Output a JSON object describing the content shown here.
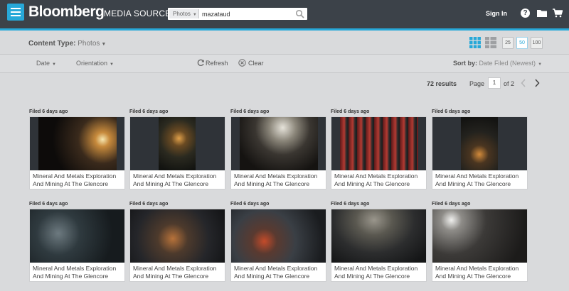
{
  "header": {
    "brand": "Bloomberg",
    "brand_sub": "MEDIA SOURCE",
    "search_type": "Photos",
    "search_value": "mazataud",
    "sign_in": "Sign In",
    "help_glyph": "?",
    "icons": [
      "menu-icon",
      "search-icon",
      "help-icon",
      "folder-icon",
      "cart-icon"
    ],
    "accent_color": "#27a8d8"
  },
  "toolbar": {
    "content_type_label": "Content Type:",
    "content_type_value": "Photos",
    "page_sizes": [
      "25",
      "50",
      "100"
    ],
    "active_page_size": "50",
    "filters": [
      "Date",
      "Orientation"
    ],
    "refresh_label": "Refresh",
    "clear_label": "Clear",
    "sort_label": "Sort by:",
    "sort_value": "Date Filed (Newest)"
  },
  "pagination": {
    "results": "72 results",
    "page_label": "Page",
    "current_page": "1",
    "of_pages": "of 2"
  },
  "items": [
    {
      "filed": "Filed 6 days ago",
      "caption": "Mineral And Metals Exploration And Mining At The Glencore"
    },
    {
      "filed": "Filed 6 days ago",
      "caption": "Mineral And Metals Exploration And Mining At The Glencore"
    },
    {
      "filed": "Filed 6 days ago",
      "caption": "Mineral And Metals Exploration And Mining At The Glencore"
    },
    {
      "filed": "Filed 6 days ago",
      "caption": "Mineral And Metals Exploration And Mining At The Glencore"
    },
    {
      "filed": "Filed 6 days ago",
      "caption": "Mineral And Metals Exploration And Mining At The Glencore"
    },
    {
      "filed": "Filed 6 days ago",
      "caption": "Mineral And Metals Exploration And Mining At The Glencore"
    },
    {
      "filed": "Filed 6 days ago",
      "caption": "Mineral And Metals Exploration And Mining At The Glencore"
    },
    {
      "filed": "Filed 6 days ago",
      "caption": "Mineral And Metals Exploration And Mining At The Glencore"
    },
    {
      "filed": "Filed 6 days ago",
      "caption": "Mineral And Metals Exploration And Mining At The Glencore"
    },
    {
      "filed": "Filed 6 days ago",
      "caption": "Mineral And Metals Exploration And Mining At The Glencore"
    }
  ]
}
